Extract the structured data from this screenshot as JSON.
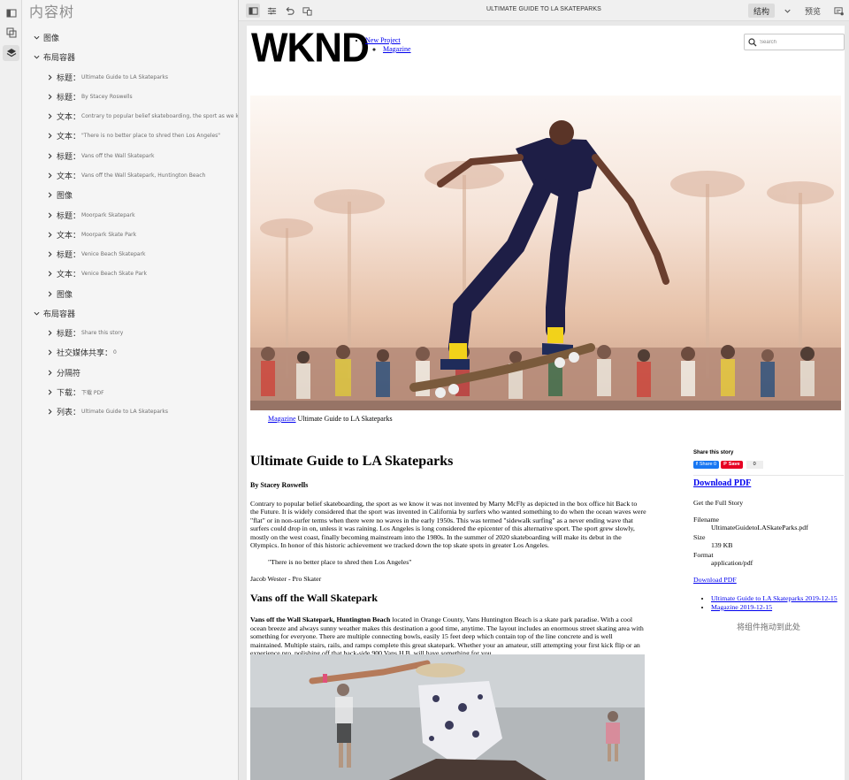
{
  "tree": {
    "title": "内容树",
    "nodes": [
      {
        "label": "图像",
        "value": ""
      },
      {
        "label": "布局容器",
        "value": ""
      },
      {
        "label": "标题：",
        "value": "Ultimate Guide to LA Skateparks"
      },
      {
        "label": "标题：",
        "value": "By Stacey Roswells"
      },
      {
        "label": "文本：",
        "value": "Contrary to popular belief skateboarding, the sport as we know"
      },
      {
        "label": "文本：",
        "value": "\"There is no better place to shred then Los Angeles\""
      },
      {
        "label": "标题：",
        "value": "Vans off the Wall Skatepark"
      },
      {
        "label": "文本：",
        "value": "Vans off the Wall Skatepark, Huntington Beach"
      },
      {
        "label": "图像",
        "value": ""
      },
      {
        "label": "标题：",
        "value": "Moorpark Skatepark"
      },
      {
        "label": "文本：",
        "value": "Moorpark Skate Park"
      },
      {
        "label": "标题：",
        "value": "Venice Beach Skatepark"
      },
      {
        "label": "文本：",
        "value": "Venice Beach Skate Park"
      },
      {
        "label": "图像",
        "value": ""
      },
      {
        "label": "布局容器",
        "value": ""
      },
      {
        "label": "标题：",
        "value": "Share this story"
      },
      {
        "label": "社交媒体共享：",
        "value": "0"
      },
      {
        "label": "分隔符",
        "value": ""
      },
      {
        "label": "下载：",
        "value": "下载 PDF"
      },
      {
        "label": "列表：",
        "value": "Ultimate Guide to LA Skateparks"
      }
    ]
  },
  "toolbar": {
    "page_title": "ULTIMATE GUIDE TO LA SKATEPARKS",
    "mode_structure": "结构",
    "mode_preview": "预览"
  },
  "page": {
    "logo": "WKND",
    "nav": {
      "item1": "New Project",
      "subitem1": "Magazine"
    },
    "search_placeholder": "Search",
    "breadcrumb": {
      "link": "Magazine",
      "current": "Ultimate Guide to LA Skateparks"
    },
    "article": {
      "title": "Ultimate Guide to LA Skateparks",
      "byline": "By Stacey Roswells",
      "para1": "Contrary to popular belief skateboarding, the sport as we know it was not invented by Marty McFly as depicted in the box office hit Back to the Future. It is widely considered that the sport was invented in California by surfers who wanted something to do when the ocean waves were \"flat\" or in non-surfer terms when there were no waves in the early 1950s. This was termed \"sidewalk surfing\" as a never ending wave that surfers could drop in on, unless it was raining. Los Angeles is long considered the epicenter of this alternative sport. The sport grew slowly, mostly on the west coast, finally becoming mainstream into the 1980s. In the summer of 2020 skateboarding will make its debut in the Olympics. In honor of this historic achievement we tracked down the top skate spots in greater Los Angeles.",
      "quote": "\"There is no better place to shred then Los Angeles\"",
      "quote_author": "Jacob Wester - Pro Skater",
      "section_title": "Vans off the Wall Skatepark",
      "para2_bold": "Vans off the Wall Skatepark, Huntington Beach",
      "para2_rest": " located in Orange County, Vans Huntington Beach is a skate park paradise. With a cool ocean breeze and always sunny weather makes this destination a good time, anytime. The layout includes an enormous street skating area with something for everyone. There are multiple connecting bowls, easily 15 feet deep which contain top of the line concrete and is well maintained. Multiple stairs, rails, and ramps complete this great skatepark. Whether your an amateur, still attempting your first kick flip or an experience pro, polishing off that back-side 900 Vans H.B. will have something for you."
    },
    "sidebar": {
      "share_title": "Share this story",
      "fb_label": "Share 0",
      "pin_label": "Save",
      "share_count": "0",
      "download_title": "Download PDF",
      "download_desc": "Get the Full Story",
      "filename_label": "Filename",
      "filename_value": "UltimateGuidetoLASkateParks.pdf",
      "size_label": "Size",
      "size_value": "139 KB",
      "format_label": "Format",
      "format_value": "application/pdf",
      "download_link": "Download PDF",
      "list": [
        "Ultimate Guide to LA Skateparks 2019-12-15",
        "Magazine 2019-12-15"
      ],
      "dropzone": "将组件拖动到此处"
    }
  }
}
